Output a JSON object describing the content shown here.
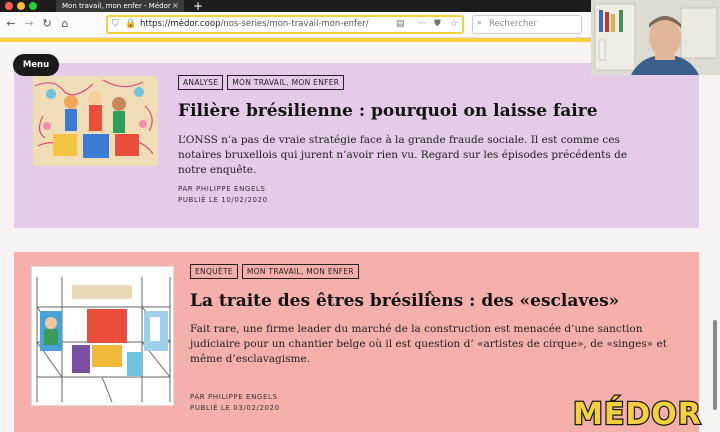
{
  "browser": {
    "tab_title": "Mon travail, mon enfer - Médor",
    "tab_close": "×",
    "new_tab": "+",
    "url_host": "https://médor.coop",
    "url_path": "/nos-series/mon-travail-mon-enfer/",
    "search_placeholder": "Rechercher"
  },
  "page": {
    "menu_label": "Menu",
    "articles": [
      {
        "tags": [
          "ANALYSE",
          "MON TRAVAIL, MON ENFER"
        ],
        "title": "Filière brésilienne : pourquoi on laisse faire",
        "description": "L’ONSS n’a pas de vraie stratégie face à la grande fraude sociale. Il est comme ces notaires bruxellois qui jurent n’avoir rien vu. Regard sur les épisodes précédents de notre enquête.",
        "author": "PAR PHILIPPE ENGELS",
        "date": "PUBLIÉ LE 10/02/2020"
      },
      {
        "tags": [
          "ENQUÊTE",
          "MON TRAVAIL, MON ENFER"
        ],
        "title": "La traite des êtres brésiliens : des «esclaves»",
        "description": "Fait rare, une firme leader du marché de la construction est menacée d’une sanction judiciaire pour un chantier belge où il est question d’ «artistes de cirque», de «singes» et même d’esclavagisme.",
        "author": "PAR PHILIPPE ENGELS",
        "date": "PUBLIÉ LE 03/02/2020"
      }
    ]
  },
  "logo_text": "MÉDOR",
  "colors": {
    "accent_yellow": "#f4d03f",
    "card_analysis": "#e4cbe8",
    "card_investigation": "#f5b0ac"
  }
}
